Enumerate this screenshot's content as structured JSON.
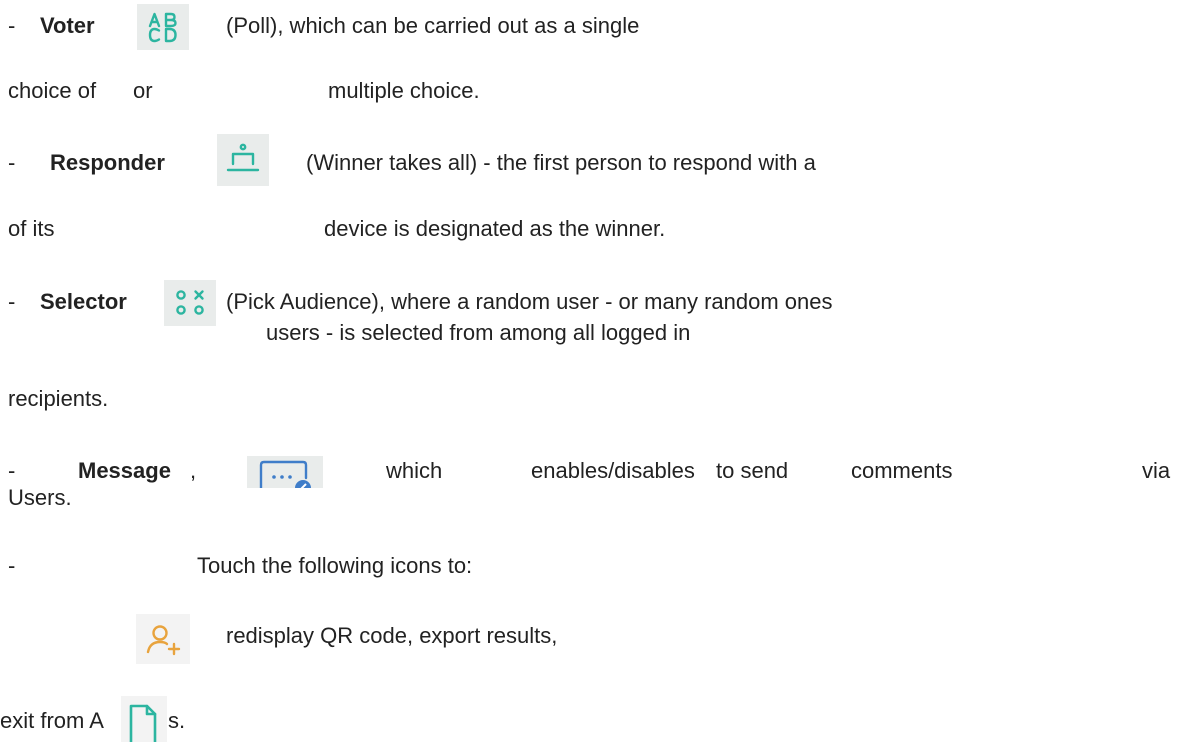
{
  "lines": {
    "voter": {
      "dash": "-",
      "name": "Voter",
      "desc": "(Poll), which can be carried out as a single",
      "cont_a": "choice of",
      "cont_b": "or",
      "cont_c": "multiple choice."
    },
    "responder": {
      "dash": "-",
      "name": "Responder",
      "desc": "(Winner takes all) - the first person to respond with a",
      "cont_a": "of its",
      "cont_b": "device is designated as the winner."
    },
    "selector": {
      "dash": "-",
      "name": "Selector",
      "desc": "(Pick Audience), where a random user - or many random ones",
      "cont_a": "users - is selected from among all logged in",
      "cont_b": "recipients."
    },
    "message": {
      "dash": "-",
      "name": "Message",
      "comma": ",",
      "w1": "which",
      "w2": "enables/disables",
      "w3": "to send",
      "w4": "comments",
      "w5": "via",
      "cont": "Users."
    },
    "touch": {
      "dash": "-",
      "text": "Touch the following icons to:"
    },
    "actions": {
      "text": "redisplay QR code, export results,",
      "exit_a": "exit from A",
      "exit_b": "s."
    }
  },
  "icons": {
    "voter": "abcd-poll-icon",
    "responder": "bell-icon",
    "selector": "pick-audience-icon",
    "message": "message-icon",
    "add_user": "add-user-icon",
    "export": "export-document-icon"
  },
  "colors": {
    "text": "#222222",
    "icon_bg": "#e9eceb",
    "icon_teal": "#2cb5a0",
    "icon_blue": "#3f7dc9",
    "icon_orange": "#e8a33d"
  }
}
